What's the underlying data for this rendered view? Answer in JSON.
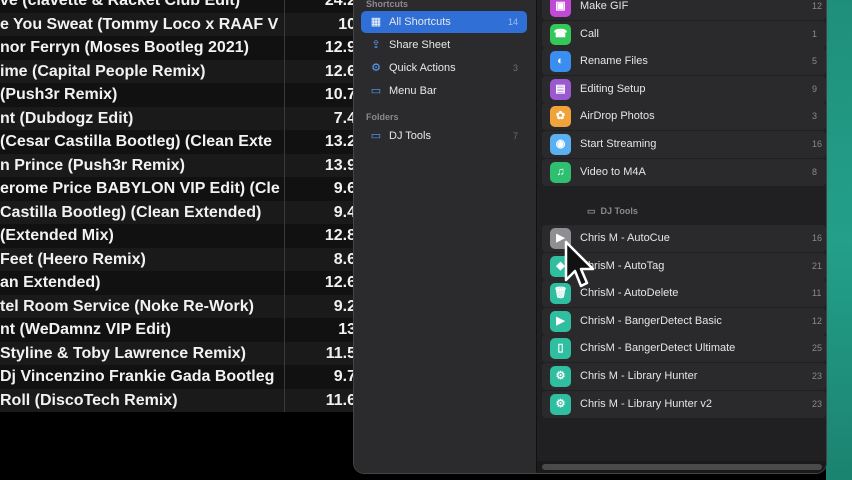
{
  "tracks": [
    {
      "title": "ve (clavette & Racket Club Edit)",
      "bpm": "24.2"
    },
    {
      "title": "e You Sweat (Tommy Loco x RAAF V",
      "bpm": "10"
    },
    {
      "title": "nor Ferryn (Moses Bootleg 2021)",
      "bpm": "12.9"
    },
    {
      "title": "ime (Capital People Remix)",
      "bpm": "12.6"
    },
    {
      "title": " (Push3r Remix)",
      "bpm": "10.7"
    },
    {
      "title": "nt (Dubdogz Edit)",
      "bpm": "7.4"
    },
    {
      "title": "(Cesar Castilla Bootleg) (Clean Exte",
      "bpm": "13.2"
    },
    {
      "title": "n Prince  (Push3r Remix)",
      "bpm": "13.9"
    },
    {
      "title": "erome Price BABYLON VIP Edit) (Cle",
      "bpm": "9.6"
    },
    {
      "title": " Castilla Bootleg) (Clean Extended)",
      "bpm": "9.4"
    },
    {
      "title": " (Extended Mix)",
      "bpm": "12.8"
    },
    {
      "title": "Feet (Heero Remix)",
      "bpm": "8.6"
    },
    {
      "title": "an Extended)",
      "bpm": "12.6"
    },
    {
      "title": "tel Room Service (Noke Re-Work)",
      "bpm": "9.2"
    },
    {
      "title": "nt (WeDamnz VIP Edit)",
      "bpm": "13"
    },
    {
      "title": "Styline & Toby Lawrence Remix)",
      "bpm": "11.5"
    },
    {
      "title": "Dj Vincenzino  Frankie Gada Bootleg",
      "bpm": "9.7"
    },
    {
      "title": "Roll (DiscoTech Remix)",
      "bpm": "11.6"
    }
  ],
  "sidebar": {
    "shortcuts_header": "Shortcuts",
    "items": [
      {
        "label": "All Shortcuts",
        "count": "14",
        "icon": "grid-icon",
        "glyph": "▦"
      },
      {
        "label": "Share Sheet",
        "count": "",
        "icon": "share-icon",
        "glyph": "⇪"
      },
      {
        "label": "Quick Actions",
        "count": "3",
        "icon": "gear-icon",
        "glyph": "⚙"
      },
      {
        "label": "Menu Bar",
        "count": "",
        "icon": "menu-bar-icon",
        "glyph": "▭"
      }
    ],
    "folders_header": "Folders",
    "folders": [
      {
        "label": "DJ Tools",
        "count": "7",
        "icon": "folder-icon",
        "glyph": "▭"
      }
    ]
  },
  "shortcuts": [
    {
      "label": "Make GIF",
      "count": "12",
      "icon": "gif-icon",
      "glyph": "▣",
      "color": "#c04ad6"
    },
    {
      "label": "Call",
      "count": "1",
      "icon": "phone-icon",
      "glyph": "☎",
      "color": "#34c759"
    },
    {
      "label": "Rename Files",
      "count": "5",
      "icon": "finder-icon",
      "glyph": "◐",
      "color": "#3a8ef0"
    },
    {
      "label": "Editing Setup",
      "count": "9",
      "icon": "edit-icon",
      "glyph": "▤",
      "color": "#9b59d0"
    },
    {
      "label": "AirDrop Photos",
      "count": "3",
      "icon": "photos-icon",
      "glyph": "✿",
      "color": "#f0a33a"
    },
    {
      "label": "Start Streaming",
      "count": "16",
      "icon": "stream-icon",
      "glyph": "◉",
      "color": "#5ab0f0"
    },
    {
      "label": "Video to M4A",
      "count": "8",
      "icon": "music-icon",
      "glyph": "♫",
      "color": "#2fbf71"
    }
  ],
  "folder_section": {
    "label": "DJ Tools"
  },
  "dj_tools": [
    {
      "label": "Chris M - AutoCue",
      "count": "16",
      "icon": "play-icon",
      "glyph": "▶",
      "color": "#8e8e93"
    },
    {
      "label": "ChrisM - AutoTag",
      "count": "21",
      "icon": "tag-icon",
      "glyph": "◆",
      "color": "#2fbfa0"
    },
    {
      "label": "ChrisM - AutoDelete",
      "count": "11",
      "icon": "trash-icon",
      "glyph": "🗑",
      "color": "#2fbfa0"
    },
    {
      "label": "ChrisM - BangerDetect Basic",
      "count": "12",
      "icon": "play-icon",
      "glyph": "▶",
      "color": "#2fbfa0"
    },
    {
      "label": "ChrisM - BangerDetect Ultimate",
      "count": "25",
      "icon": "document-icon",
      "glyph": "▯",
      "color": "#2fbfa0"
    },
    {
      "label": "Chris M - Library Hunter",
      "count": "23",
      "icon": "gear-icon",
      "glyph": "⚙",
      "color": "#2fbfa0"
    },
    {
      "label": "Chris M - Library Hunter v2",
      "count": "23",
      "icon": "gear-icon",
      "glyph": "⚙",
      "color": "#2fbfa0"
    }
  ]
}
